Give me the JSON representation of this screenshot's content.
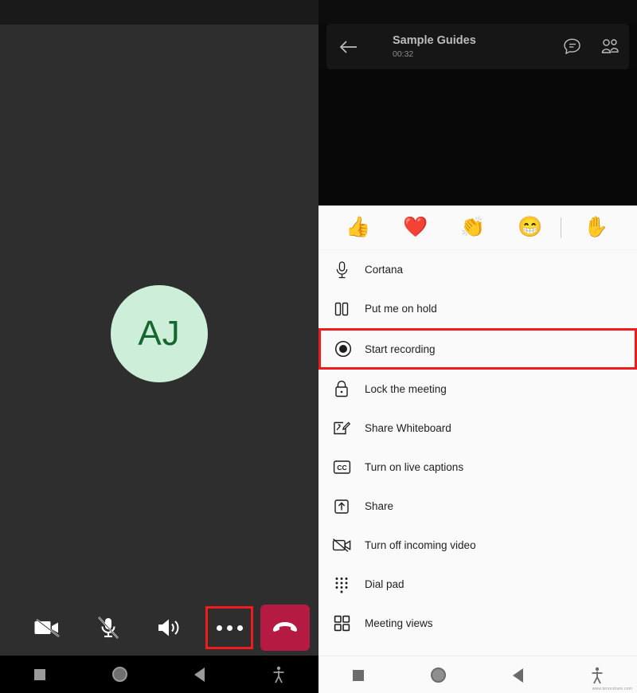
{
  "left_panel": {
    "video_area": {
      "avatar_initials": "AJ",
      "avatar_bg_color": "#cdeed9",
      "avatar_text_color": "#14682f"
    },
    "controls": [
      {
        "name": "camera-off",
        "label": "Camera off",
        "icon": "video-off-icon",
        "highlighted": false
      },
      {
        "name": "mic-off",
        "label": "Microphone muted",
        "icon": "mic-off-icon",
        "highlighted": false
      },
      {
        "name": "speaker",
        "label": "Speaker",
        "icon": "speaker-icon",
        "highlighted": false
      },
      {
        "name": "more-options",
        "label": "More options",
        "icon": "more-dots-icon",
        "highlighted": true
      },
      {
        "name": "hang-up",
        "label": "Hang up",
        "icon": "hangup-icon",
        "highlighted": false
      }
    ],
    "hangup_color": "#b51b42",
    "highlight_color": "#ee1c1c",
    "system_nav": [
      {
        "name": "recents-button",
        "icon": "square-icon"
      },
      {
        "name": "home-button",
        "icon": "circle-icon"
      },
      {
        "name": "back-button",
        "icon": "triangle-back-icon"
      },
      {
        "name": "accessibility-button",
        "icon": "accessibility-icon"
      }
    ]
  },
  "right_panel": {
    "header": {
      "back_icon": "arrow-left-icon",
      "title": "Sample Guides",
      "timer": "00:32",
      "chat_icon": "chat-bubble-icon",
      "participants_icon": "people-icon"
    },
    "reactions": [
      {
        "name": "reaction-thumbs-up",
        "icon": "thumbs-up-emoji",
        "glyph": "👍"
      },
      {
        "name": "reaction-heart",
        "icon": "heart-emoji",
        "glyph": "❤️"
      },
      {
        "name": "reaction-applause",
        "icon": "clapping-hands-emoji",
        "glyph": "👏"
      },
      {
        "name": "reaction-laugh",
        "icon": "grinning-face-emoji",
        "glyph": "😁"
      },
      {
        "name": "reaction-raise-hand",
        "icon": "raised-hand-emoji",
        "glyph": "✋"
      }
    ],
    "menu_items": [
      {
        "name": "menu-item-cortana",
        "label": "Cortana",
        "icon": "microphone-icon",
        "highlighted": false
      },
      {
        "name": "menu-item-put-me-on-hold",
        "label": "Put me on hold",
        "icon": "pause-icon",
        "highlighted": false
      },
      {
        "name": "menu-item-start-recording",
        "label": "Start recording",
        "icon": "record-icon",
        "highlighted": true
      },
      {
        "name": "menu-item-lock-the-meeting",
        "label": "Lock the meeting",
        "icon": "lock-icon",
        "highlighted": false
      },
      {
        "name": "menu-item-share-whiteboard",
        "label": "Share Whiteboard",
        "icon": "whiteboard-icon",
        "highlighted": false
      },
      {
        "name": "menu-item-turn-on-live-captions",
        "label": "Turn on live captions",
        "icon": "closed-captions-icon",
        "highlighted": false
      },
      {
        "name": "menu-item-share",
        "label": "Share",
        "icon": "share-up-arrow-icon",
        "highlighted": false
      },
      {
        "name": "menu-item-turn-off-incoming-video",
        "label": "Turn off incoming video",
        "icon": "video-off-icon",
        "highlighted": false
      },
      {
        "name": "menu-item-dial-pad",
        "label": "Dial pad",
        "icon": "dial-pad-icon",
        "highlighted": false
      },
      {
        "name": "menu-item-meeting-views",
        "label": "Meeting views",
        "icon": "grid-views-icon",
        "highlighted": false
      }
    ],
    "highlight_color": "#ee1c1c",
    "sheet_bg_color": "#fafafa",
    "system_nav": [
      {
        "name": "recents-button",
        "icon": "square-icon"
      },
      {
        "name": "home-button",
        "icon": "circle-icon"
      },
      {
        "name": "back-button",
        "icon": "triangle-back-icon"
      },
      {
        "name": "accessibility-button",
        "icon": "accessibility-icon"
      }
    ],
    "watermark": "www.tenorshare.com"
  }
}
